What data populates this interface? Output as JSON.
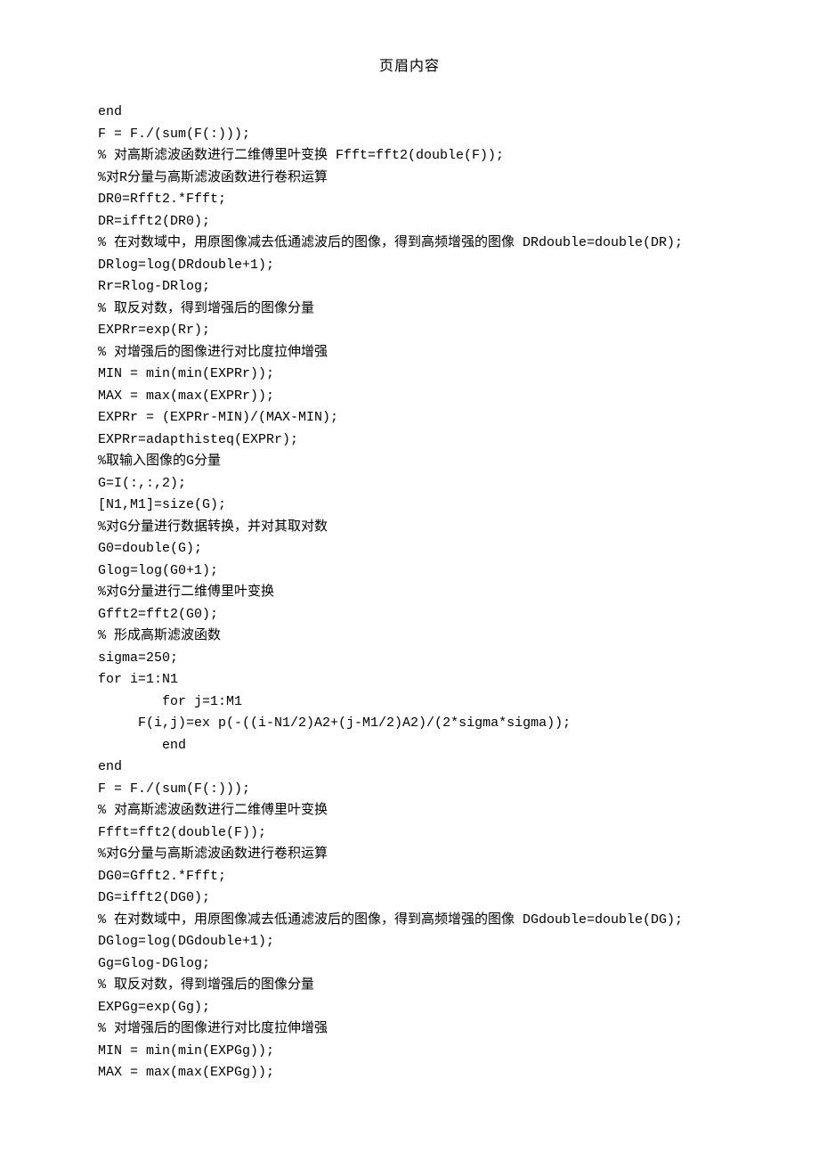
{
  "header": "页眉内容",
  "code": {
    "lines": [
      "end",
      "F = F./(sum(F(:)));",
      "% 对高斯滤波函数进行二维傅里叶变换 Ffft=fft2(double(F));",
      "%对R分量与高斯滤波函数进行卷积运算",
      "DR0=Rfft2.*Ffft;",
      "DR=ifft2(DR0);",
      "% 在对数域中，用原图像减去低通滤波后的图像，得到高频增强的图像 DRdouble=double(DR);",
      "DRlog=log(DRdouble+1);",
      "Rr=Rlog-DRlog;",
      "% 取反对数，得到增强后的图像分量",
      "EXPRr=exp(Rr);",
      "% 对增强后的图像进行对比度拉伸增强",
      "MIN = min(min(EXPRr));",
      "MAX = max(max(EXPRr));",
      "EXPRr = (EXPRr-MIN)/(MAX-MIN);",
      "EXPRr=adapthisteq(EXPRr);",
      "%取输入图像的G分量",
      "G=I(:,:,2);",
      "[N1,M1]=size(G);",
      "%对G分量进行数据转换，并对其取对数",
      "G0=double(G);",
      "Glog=log(G0+1);",
      "%对G分量进行二维傅里叶变换",
      "Gfft2=fft2(G0);",
      "% 形成高斯滤波函数",
      "sigma=250;",
      "for i=1:N1",
      "        for j=1:M1",
      "     F(i,j)=ex p(-((i-N1/2)A2+(j-M1/2)A2)/(2*sigma*sigma));",
      "        end",
      "end",
      "F = F./(sum(F(:)));",
      "% 对高斯滤波函数进行二维傅里叶变换",
      "Ffft=fft2(double(F));",
      "%对G分量与高斯滤波函数进行卷积运算",
      "DG0=Gfft2.*Ffft;",
      "DG=ifft2(DG0);",
      "% 在对数域中，用原图像减去低通滤波后的图像，得到高频增强的图像 DGdouble=double(DG);",
      "DGlog=log(DGdouble+1);",
      "Gg=Glog-DGlog;",
      "% 取反对数，得到增强后的图像分量",
      "EXPGg=exp(Gg);",
      "% 对增强后的图像进行对比度拉伸增强",
      "MIN = min(min(EXPGg));",
      "MAX = max(max(EXPGg));"
    ]
  }
}
